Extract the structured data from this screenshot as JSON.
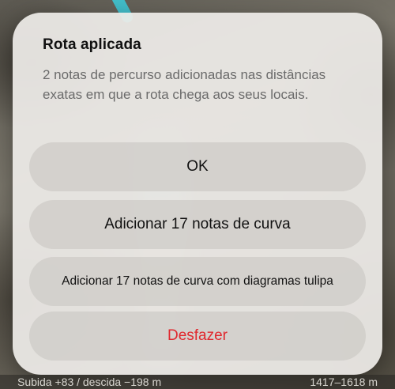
{
  "dialog": {
    "title": "Rota aplicada",
    "message": "2 notas de percurso adicionadas nas distâncias exatas em que a rota chega aos seus locais.",
    "actions": {
      "ok": "OK",
      "add_turn_notes": "Adicionar 17 notas de curva",
      "add_turn_notes_tulip": "Adicionar 17 notas de curva com diagramas tulipa",
      "undo": "Desfazer"
    }
  },
  "status": {
    "elevation": "Subida +83 / descida −198 m",
    "altitude_range": "1417–1618 m"
  },
  "colors": {
    "destructive": "#e0282e",
    "route": "#3ec9d6"
  }
}
